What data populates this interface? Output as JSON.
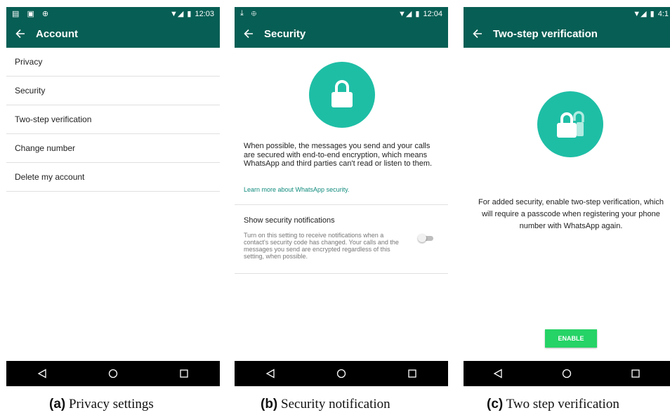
{
  "screens": [
    {
      "status": {
        "left": "▤ ▣ ⊕",
        "time": "12:03"
      },
      "title": "Account",
      "items": [
        "Privacy",
        "Security",
        "Two-step verification",
        "Change number",
        "Delete my account"
      ]
    },
    {
      "status": {
        "left": "⤓ ⊕",
        "time": "12:04"
      },
      "title": "Security",
      "body": "When possible, the messages you send and your calls are secured with end-to-end encryption, which means WhatsApp and third parties can't read or listen to them.",
      "link": "Learn more about WhatsApp security.",
      "toggle_title": "Show security notifications",
      "toggle_desc": "Turn on this setting to receive notifications when a contact's security code has changed. Your calls and the messages you send are encrypted regardless of this setting, when possible.",
      "toggle_on": false
    },
    {
      "status": {
        "left": "",
        "time": "4:1"
      },
      "title": "Two-step verification",
      "body": "For added security, enable two-step verification, which will require a passcode when registering your phone number with WhatsApp again.",
      "button": "ENABLE"
    }
  ],
  "captions": [
    {
      "label": "(a)",
      "text": "Privacy settings"
    },
    {
      "label": "(b)",
      "text": "Security notification"
    },
    {
      "label": "(c)",
      "text": "Two step verification"
    }
  ],
  "colors": {
    "appbar": "#075e54",
    "accent": "#1ebea5",
    "button": "#25d366",
    "link": "#128c7e"
  }
}
